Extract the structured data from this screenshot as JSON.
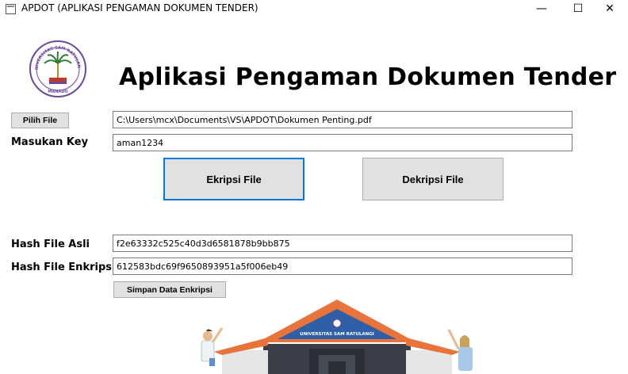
{
  "window": {
    "title": "APDOT (APLIKASI PENGAMAN DOKUMEN TENDER)",
    "minimize": "—",
    "maximize": "☐",
    "close": "✕"
  },
  "header": {
    "title": "Aplikasi Pengaman Dokumen Tender",
    "logo_text_top": "UNIVERSITAS SAM RATULANGI",
    "logo_text_bottom": "MANADO"
  },
  "form": {
    "pick_file_label": "Pilih File",
    "file_path": "C:\\Users\\mcx\\Documents\\VS\\APDOT\\Dokumen Penting.pdf",
    "key_label": "Masukan Key",
    "key_value": "aman1234",
    "encrypt_label": "Ekripsi File",
    "decrypt_label": "Dekripsi File",
    "hash_original_label": "Hash File Asli",
    "hash_original_value": "f2e63332c525c40d3d6581878b9bb875",
    "hash_encrypted_label": "Hash File Enkripsi",
    "hash_encrypted_value": "612583bdc69f9650893951a5f006eb49",
    "save_label": "Simpan Data Enkripsi"
  },
  "illustration": {
    "building_sign": "UNIVERSITAS SAM RATULANGI"
  },
  "colors": {
    "accent_border": "#0078d7",
    "button_bg": "#e1e1e1",
    "roof": "#e8743b",
    "logo_purple": "#6a4a9c"
  }
}
